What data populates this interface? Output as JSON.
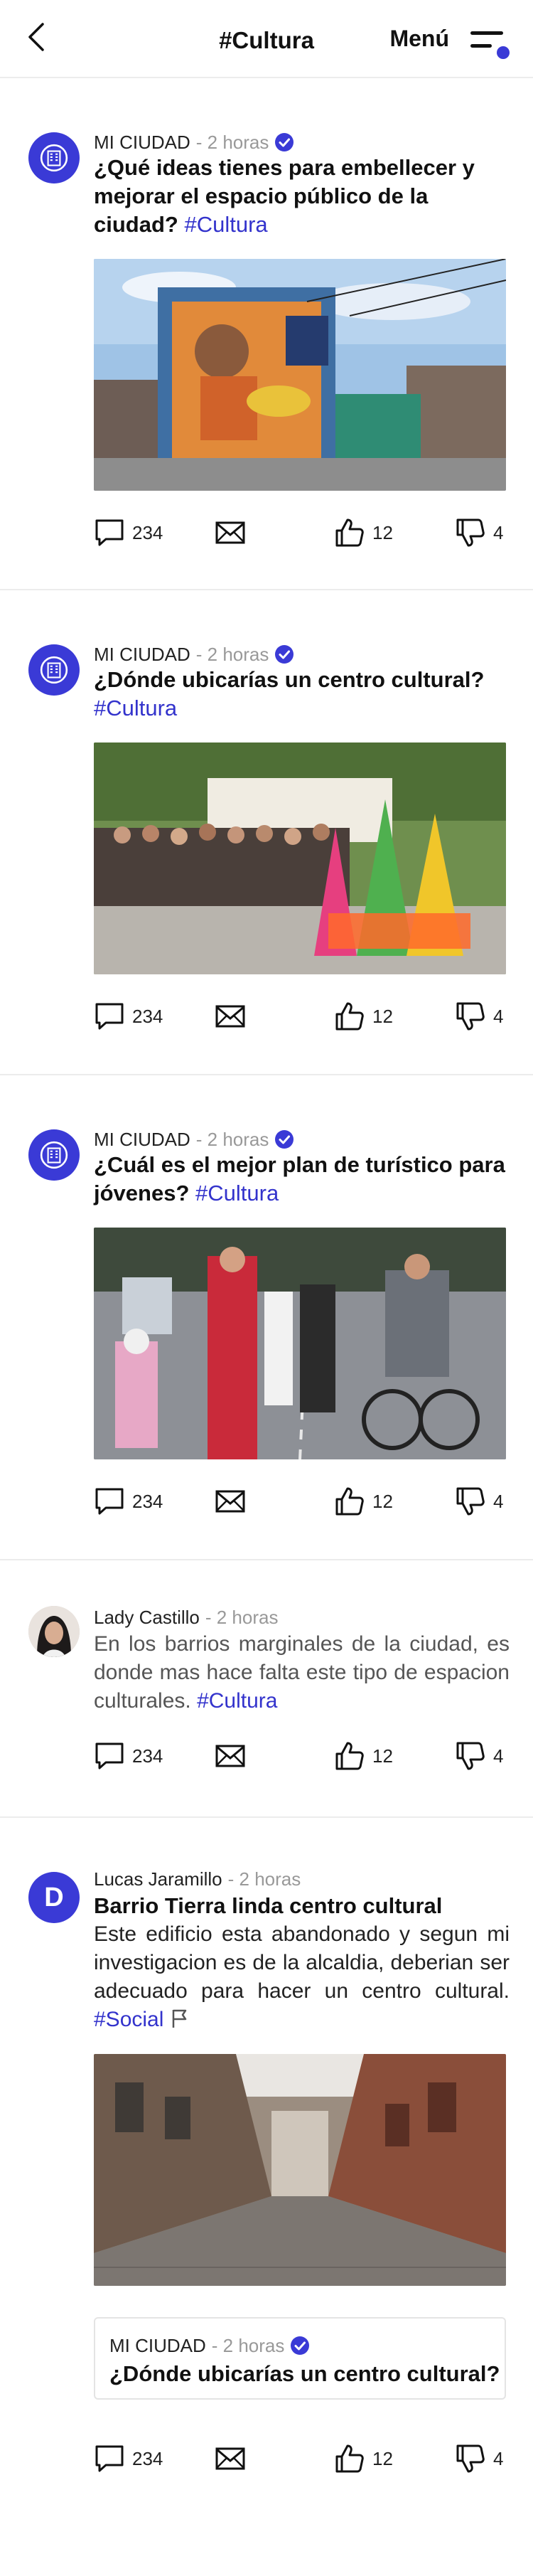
{
  "header": {
    "title": "#Cultura",
    "menu_label": "Menú"
  },
  "colors": {
    "accent": "#3a3ad6",
    "hashtag": "#3333cc",
    "muted": "#999999"
  },
  "posts": [
    {
      "author": "MI CIUDAD",
      "time": "- 2 horas",
      "verified": true,
      "title": "¿Qué ideas tienes para embellecer y mejorar el espacio público de la ciudad?",
      "hashtag": "#Cultura",
      "image": "street-mural-photo",
      "comments": "234",
      "likes": "12",
      "dislikes": "4"
    },
    {
      "author": "MI CIUDAD",
      "time": "- 2 horas",
      "verified": true,
      "title": "¿Dónde ubicarías un centro cultural?",
      "hashtag": "#Cultura",
      "image": "street-dancers-photo",
      "comments": "234",
      "likes": "12",
      "dislikes": "4"
    },
    {
      "author": "MI CIUDAD",
      "time": "- 2 horas",
      "verified": true,
      "title": "¿Cuál es el mejor plan de turístico para jóvenes?",
      "hashtag": "#Cultura",
      "image": "ciclovia-photo",
      "comments": "234",
      "likes": "12",
      "dislikes": "4"
    },
    {
      "author": "Lady Castillo",
      "time": "- 2 horas",
      "verified": false,
      "text": "En los barrios marginales de la ciudad, es donde mas hace falta este tipo de espacion culturales.",
      "hashtag": "#Cultura",
      "comments": "234",
      "likes": "12",
      "dislikes": "4"
    },
    {
      "author": "Lucas Jaramillo",
      "avatar_letter": "D",
      "time": "- 2 horas",
      "verified": false,
      "title": "Barrio Tierra linda centro cultural",
      "text": "Este edificio esta abandonado y segun mi investigacion es de la alcaldia, deberian ser adecuado para hacer un centro cultural.",
      "hashtag": "#Social",
      "image": "old-street-photo",
      "quote": {
        "author": "MI CIUDAD",
        "time": "- 2 horas",
        "title": "¿Dónde ubicarías un centro cultural?"
      },
      "comments": "234",
      "likes": "12",
      "dislikes": "4"
    }
  ]
}
